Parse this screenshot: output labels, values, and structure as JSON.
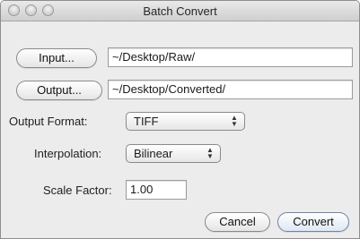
{
  "window": {
    "title": "Batch Convert"
  },
  "input": {
    "button_label": "Input...",
    "path": "~/Desktop/Raw/"
  },
  "output": {
    "button_label": "Output...",
    "path": "~/Desktop/Converted/"
  },
  "output_format": {
    "label": "Output Format:",
    "selected": "TIFF"
  },
  "interpolation": {
    "label": "Interpolation:",
    "selected": "Bilinear"
  },
  "scale_factor": {
    "label": "Scale Factor:",
    "value": "1.00"
  },
  "actions": {
    "cancel_label": "Cancel",
    "convert_label": "Convert"
  },
  "icons": {
    "close": "close-icon",
    "minimize": "minimize-icon",
    "zoom": "zoom-icon",
    "popup_arrows": "up-down-arrows-icon"
  }
}
